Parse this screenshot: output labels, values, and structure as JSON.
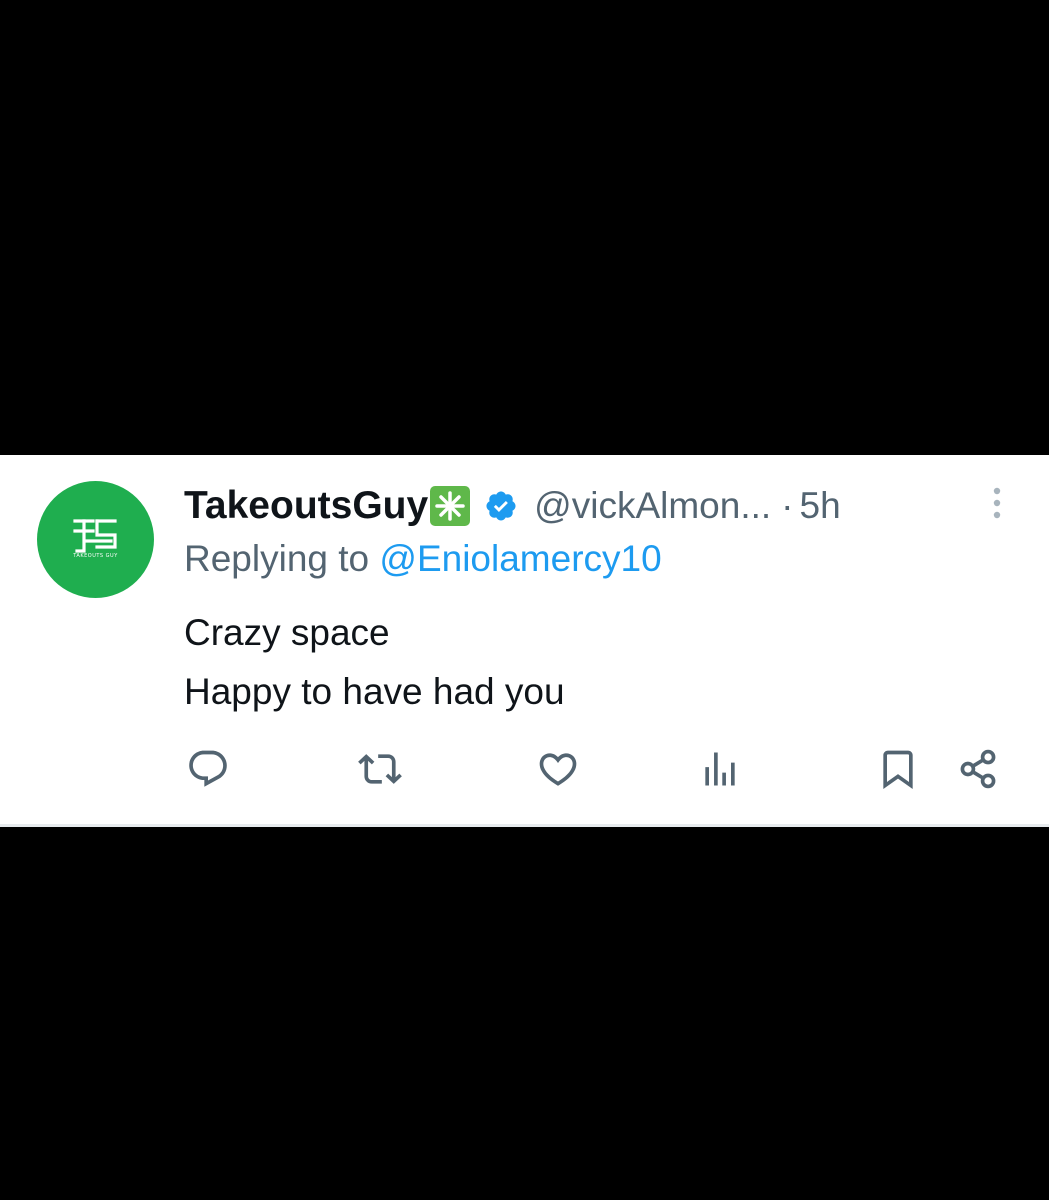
{
  "tweet": {
    "display_name": "TakeoutsGuy",
    "name_emoji": "sparkle-emoji",
    "verified_icon": "verified-badge-icon",
    "handle": "@vickAlmon...",
    "separator": "·",
    "time": "5h",
    "replying_prefix": "Replying to ",
    "replying_to": "@Eniolamercy10",
    "text_lines": [
      "Crazy space",
      "Happy to have had you"
    ],
    "avatar": {
      "logo_text": "TAKEOUTS GUY",
      "background_color": "#1fae4f"
    },
    "actions": [
      "reply-icon",
      "retweet-icon",
      "like-icon",
      "views-icon",
      "bookmark-icon",
      "share-icon"
    ]
  },
  "colors": {
    "background": "#000000",
    "card": "#ffffff",
    "text_primary": "#0f1419",
    "text_secondary": "#536471",
    "link": "#1d9bf0",
    "verified": "#1d9bf0"
  }
}
